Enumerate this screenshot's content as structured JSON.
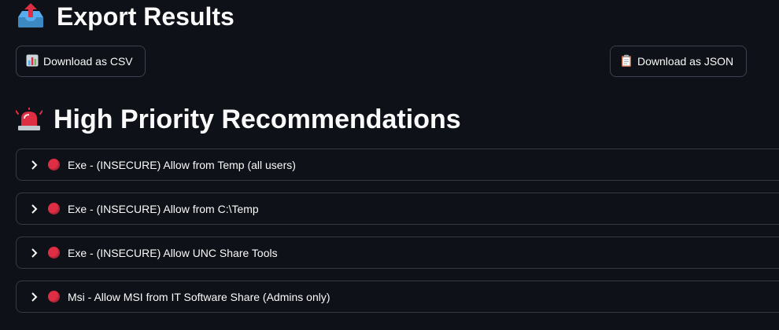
{
  "export": {
    "title": "Export Results",
    "icon": "outbox-tray-icon",
    "buttons": [
      {
        "label": "Download as CSV",
        "icon": "bar-chart-icon"
      },
      {
        "label": "Download as JSON",
        "icon": "clipboard-icon"
      }
    ]
  },
  "recommendations": {
    "title": "High Priority Recommendations",
    "icon": "police-light-icon",
    "items": [
      {
        "label": "Exe - (INSECURE) Allow from Temp (all users)",
        "status_color": "#dd2e44"
      },
      {
        "label": "Exe - (INSECURE) Allow from C:\\Temp",
        "status_color": "#dd2e44"
      },
      {
        "label": "Exe - (INSECURE) Allow UNC Share Tools",
        "status_color": "#dd2e44"
      },
      {
        "label": "Msi - Allow MSI from IT Software Share (Admins only)",
        "status_color": "#dd2e44"
      }
    ]
  },
  "colors": {
    "background": "#0e1117",
    "border": "#373a46",
    "text": "#fafafa"
  }
}
